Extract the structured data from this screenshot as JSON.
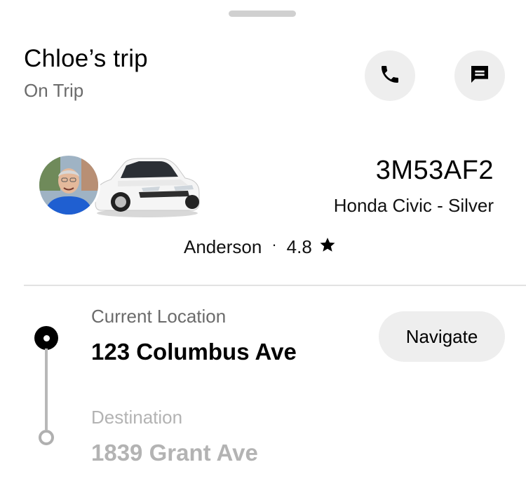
{
  "header": {
    "title": "Chloe’s trip",
    "status": "On Trip"
  },
  "actions": {
    "call_icon": "phone-icon",
    "message_icon": "chat-icon"
  },
  "vehicle": {
    "plate": "3M53AF2",
    "description": "Honda Civic - Silver"
  },
  "driver": {
    "name": "Anderson",
    "separator": "·",
    "rating": "4.8",
    "rating_icon": "star-icon"
  },
  "route": {
    "current_label": "Current Location",
    "current_value": "123 Columbus Ave",
    "destination_label": "Destination",
    "destination_value": "1839 Grant Ave",
    "navigate_label": "Navigate"
  },
  "colors": {
    "button_bg": "#eeeeee",
    "muted_text": "#6b6b6b",
    "disabled_text": "#b3b3b3"
  }
}
